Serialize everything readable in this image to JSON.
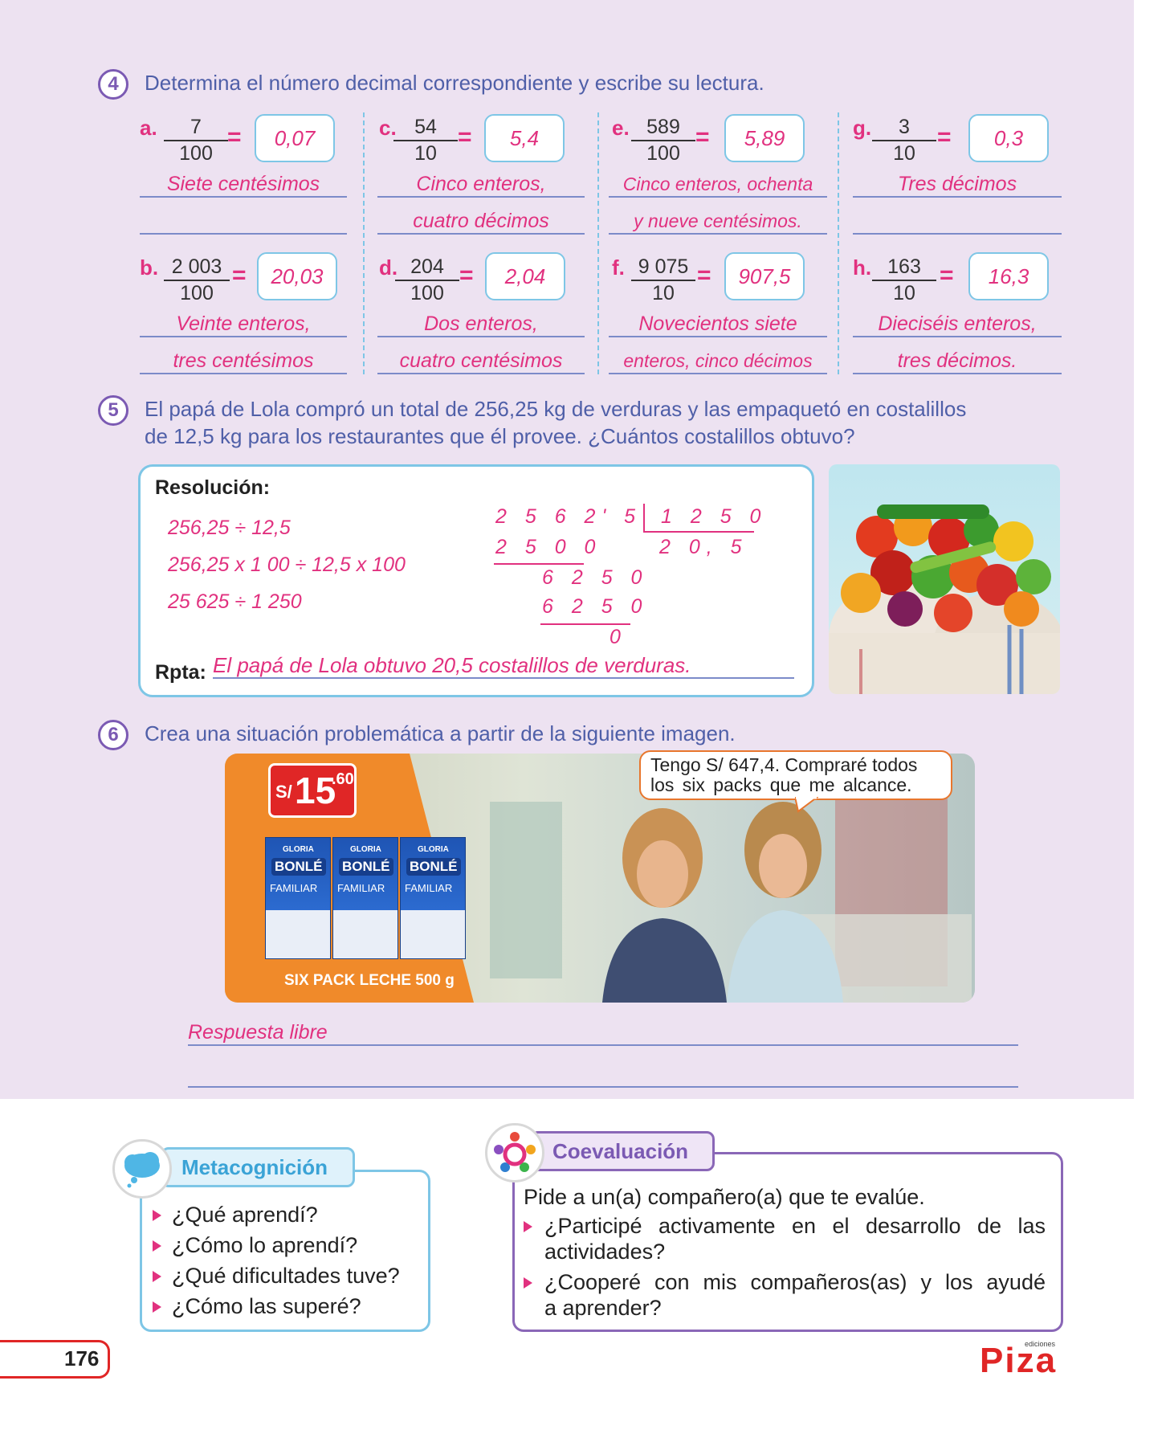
{
  "q4": {
    "number": "4",
    "instruction": "Determina el número decimal correspondiente y escribe su lectura.",
    "items": [
      {
        "letter": "a.",
        "num": "7",
        "den": "100",
        "answer": "0,07",
        "line1": "Siete centésimos",
        "line2": ""
      },
      {
        "letter": "c.",
        "num": "54",
        "den": "10",
        "answer": "5,4",
        "line1": "Cinco enteros,",
        "line2": "cuatro décimos"
      },
      {
        "letter": "e.",
        "num": "589",
        "den": "100",
        "answer": "5,89",
        "line1": "Cinco enteros, ochenta",
        "line2": "y nueve centésimos."
      },
      {
        "letter": "g.",
        "num": "3",
        "den": "10",
        "answer": "0,3",
        "line1": "Tres décimos",
        "line2": ""
      },
      {
        "letter": "b.",
        "num": "2 003",
        "den": "100",
        "answer": "20,03",
        "line1": "Veinte enteros,",
        "line2": "tres centésimos"
      },
      {
        "letter": "d.",
        "num": "204",
        "den": "100",
        "answer": "2,04",
        "line1": "Dos enteros,",
        "line2": "cuatro centésimos"
      },
      {
        "letter": "f.",
        "num": "9 075",
        "den": "10",
        "answer": "907,5",
        "line1": "Novecientos siete",
        "line2": "enteros, cinco décimos"
      },
      {
        "letter": "h.",
        "num": "163",
        "den": "10",
        "answer": "16,3",
        "line1": "Dieciséis enteros,",
        "line2": "tres décimos."
      }
    ],
    "equals": "="
  },
  "q5": {
    "number": "5",
    "statement_line1": "El papá de Lola compró un total de 256,25 kg de verduras y las empaquetó en costalillos",
    "statement_line2": "de 12,5 kg para los restaurantes que él provee. ¿Cuántos costalillos obtuvo?",
    "resolution_label": "Resolución:",
    "steps": [
      "256,25 ÷ 12,5",
      "256,25 x 1 00 ÷ 12,5 x 100",
      "25 625 ÷ 1 250"
    ],
    "division": {
      "dividend": "2 5 6 2' 5",
      "divisor": "1 2 5 0",
      "quotient": "2 0, 5",
      "rows": [
        "2 5 0 0",
        "6 2 5 0",
        "6 2 5 0",
        "0"
      ]
    },
    "answer_label": "Rpta:",
    "answer": "El papá de Lola obtuvo 20,5 costalillos de verduras."
  },
  "q6": {
    "number": "6",
    "instruction": "Crea una situación problemática a partir de la siguiente imagen.",
    "price_currency": "S/",
    "price_main": "15",
    "price_cents": ".60",
    "product_brand": "GLORIA",
    "product_name": "BONLÉ",
    "product_variant": "FAMILIAR",
    "product_caption": "SIX PACK LECHE 500 g",
    "speech_line1": "Tengo S/ 647,4. Compraré todos",
    "speech_line2": "los six packs que me alcance.",
    "response": "Respuesta libre"
  },
  "meta": {
    "title": "Metacognición",
    "items": [
      "¿Qué aprendí?",
      "¿Cómo lo aprendí?",
      "¿Qué dificultades tuve?",
      "¿Cómo las superé?"
    ]
  },
  "coeval": {
    "title": "Coevaluación",
    "intro": "Pide a un(a) compañero(a) que te evalúe.",
    "item1_line1": "¿Participé activamente en el desarrollo de las",
    "item1_line2": "actividades?",
    "item2_line1": "¿Cooperé con mis compañeros(as) y los ayudé",
    "item2_line2": "a aprender?"
  },
  "footer": {
    "page_number": "176",
    "logo_small": "ediciones",
    "logo": "Piza"
  },
  "colors": {
    "accent_pink": "#e1317f",
    "instruction_blue": "#4f5fa8",
    "border_cyan": "#7ec6e6",
    "purple": "#7b5ab3",
    "background": "#ede2f1"
  }
}
